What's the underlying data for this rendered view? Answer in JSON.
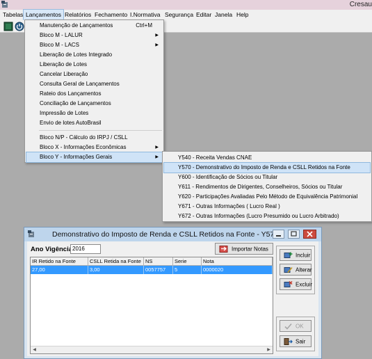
{
  "window": {
    "app_title": "Cresau"
  },
  "menubar": [
    "Tabelas",
    "Lançamentos",
    "Relatórios",
    "Fechamento",
    "I.Normativa",
    "Segurança",
    "Editar",
    "Janela",
    "Help"
  ],
  "menu_lancamentos": {
    "items": [
      {
        "label": "Manutenção de Lançamentos",
        "shortcut": "Ctrl+M",
        "arrow": ""
      },
      {
        "label": "Bloco M - LALUR",
        "shortcut": "",
        "arrow": "▶"
      },
      {
        "label": "Bloco M - LACS",
        "shortcut": "",
        "arrow": "▶"
      },
      {
        "label": "Liberação de Lotes Integrado",
        "shortcut": "",
        "arrow": ""
      },
      {
        "label": "Liberação de Lotes",
        "shortcut": "",
        "arrow": ""
      },
      {
        "label": "Cancelar Liberação",
        "shortcut": "",
        "arrow": ""
      },
      {
        "label": "Consulta Geral de Lançamentos",
        "shortcut": "",
        "arrow": ""
      },
      {
        "label": "Rateio  dos Lançamentos",
        "shortcut": "",
        "arrow": ""
      },
      {
        "label": "Conciliação de Lançamentos",
        "shortcut": "",
        "arrow": ""
      },
      {
        "label": "Impressão de Lotes",
        "shortcut": "",
        "arrow": ""
      },
      {
        "label": "Envio de lotes AutoBrasil",
        "shortcut": "",
        "arrow": ""
      },
      {
        "label": "Bloco N/P - Cálculo do IRPJ / CSLL",
        "shortcut": "",
        "arrow": ""
      },
      {
        "label": "Bloco X - Informações Econômicas",
        "shortcut": "",
        "arrow": "▶"
      },
      {
        "label": "Bloco Y - Informações Gerais",
        "shortcut": "",
        "arrow": "▶"
      }
    ]
  },
  "submenu_bloco_y": {
    "items": [
      "Y540 - Receita Vendas CNAE",
      "Y570 - Demonstrativo do Imposto de Renda e CSLL Retidos na Fonte",
      "Y600 - Identificação de Sócios ou Titular",
      "Y611 - Rendimentos de Dirigentes, Conselheiros, Sócios ou Titular",
      "Y620 - Participações Avaliadas Pelo Método de Equivalência Patrimonial",
      "Y671 - Outras Informações ( Lucro Real )",
      "Y672 - Outras Informações (Lucro Presumido ou Lucro Arbitrado)"
    ]
  },
  "dialog": {
    "title": "Demonstrativo do Imposto de Renda e CSLL Retidos na Fonte - Y570",
    "year_label": "Ano Vigência",
    "year_value": "2016",
    "import_button": "Importar Notas",
    "columns": [
      "IR Retido na Fonte",
      "CSLL Retida na Fonte",
      "NS",
      "Serie",
      "Nota"
    ],
    "rows": [
      [
        "27,00",
        "3,00",
        "0057757",
        "5",
        "0000020"
      ]
    ],
    "buttons": {
      "incluir": "Incluir",
      "alterar": "Alterar",
      "excluir": "Excluir",
      "ok": "OK",
      "sair": "Sair"
    }
  },
  "colors": {
    "desktop": "#ababab",
    "titlebar": "#e6d2dc",
    "dialog_title": "#bed5ec",
    "selected_row": "#3399ff",
    "menu_highlight": "#cfe3f7"
  }
}
